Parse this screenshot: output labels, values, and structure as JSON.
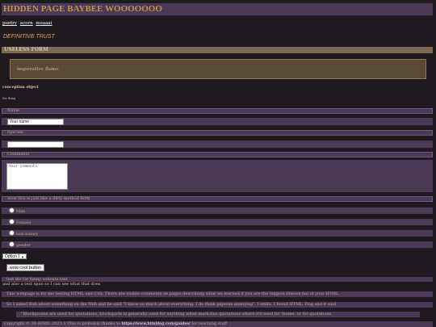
{
  "header": {
    "title": "HIDDEN PAGE BAYBEE WOOOOOOO"
  },
  "nav": {
    "links": [
      "poetry",
      "acorn",
      "meaaai"
    ]
  },
  "tagline": "DEFINITIVE TRUST",
  "form_section": {
    "title": "USELESS FORM"
  },
  "important_box": {
    "text": "imperative flame"
  },
  "captions": {
    "caption1": "conception object",
    "caption2": "the thing"
  },
  "form": {
    "name_label": "Name",
    "name_value": "Your name",
    "species_label": "Species",
    "species_value": "",
    "comments_label": "Comments",
    "comments_placeholder": "Your comments",
    "question_label": "wow this is just like a dirty method form",
    "radio_options": [
      "Man",
      "Female",
      "non-binary",
      "gender"
    ],
    "select_value": "Option 1",
    "button_label": "wow cool button"
  },
  "bottom": {
    "fake_title": "lost div for funny website text",
    "also_text": "and also a text span so I can see what that does",
    "para1": "This webpage is for me testing HTML and CSS. There are visible comments on pages describing what we learned if you are the biggest Elmore fan of your HTML",
    "para2": "So I asked Bob about something on the Web and he said \"I know so much about everything, I do think pigeons annoying\". I smile, I found HTML. Dog and it said",
    "quote": "\"Blockquotes are used for quotations, blockquote is generally used for anything when mark-line quotations where it's used for theme, or for quotations.",
    "footer_prefix": "Copyright © 30 APRIL 2023 // This is probably thanks to ",
    "footer_link": "https://www.htmldog.com/guides/",
    "footer_suffix": " for teaching stuff"
  }
}
